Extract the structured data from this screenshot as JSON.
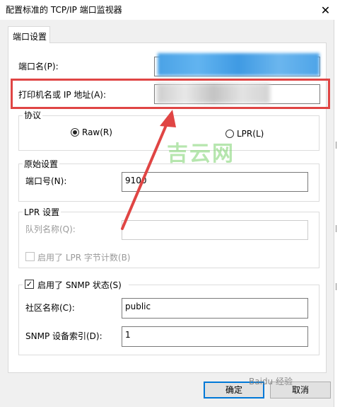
{
  "window": {
    "title": "配置标准的 TCP/IP 端口监视器",
    "close_glyph": "✕"
  },
  "tabs": [
    {
      "label": "端口设置"
    }
  ],
  "port_settings": {
    "port_name_label": "端口名(P):",
    "printer_label": "打印机名或 IP 地址(A):",
    "protocol": {
      "title": "协议",
      "raw_label": "Raw(R)",
      "lpr_label": "LPR(L)",
      "selected": "Raw"
    },
    "raw_settings": {
      "title": "原始设置",
      "port_number_label": "端口号(N):",
      "port_number_value": "9100"
    },
    "lpr_settings": {
      "title": "LPR 设置",
      "queue_name_label": "队列名称(Q):",
      "queue_name_value": "",
      "byte_count_label": "启用了 LPR 字节计数(B)",
      "byte_count_checked": false
    },
    "snmp": {
      "title": "启用了 SNMP 状态(S)",
      "enabled": true,
      "check_glyph": "✓",
      "community_label": "社区名称(C):",
      "community_value": "public",
      "device_index_label": "SNMP 设备索引(D):",
      "device_index_value": "1"
    }
  },
  "buttons": {
    "ok": "确定",
    "cancel": "取消"
  },
  "watermarks": {
    "center": "吉云网",
    "corner": "Baidu 经验"
  },
  "colors": {
    "highlight": "#e04544",
    "arrow": "#e04544",
    "accent": "#0078d7"
  }
}
